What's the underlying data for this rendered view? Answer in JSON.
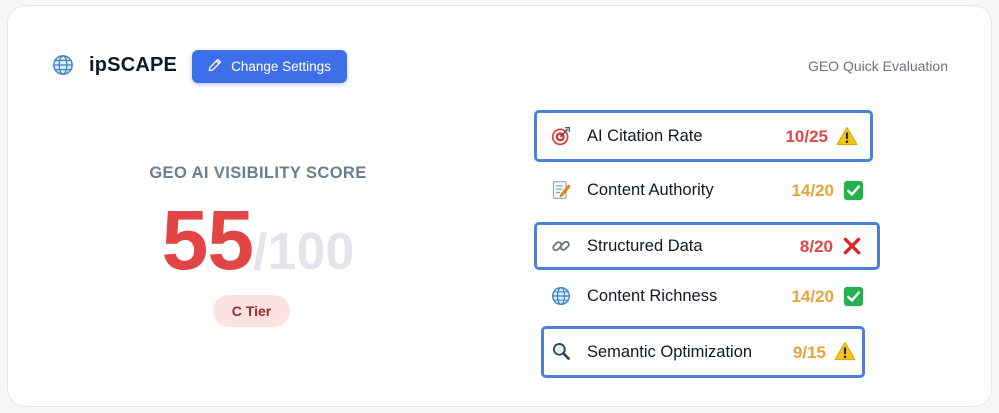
{
  "header": {
    "brand_name": "ipSCAPE",
    "brand_icon": "globe-icon",
    "change_settings_label": "Change Settings",
    "change_settings_icon": "pencil-icon",
    "evaluation_label": "GEO Quick Evaluation"
  },
  "score": {
    "label": "GEO AI VISIBILITY SCORE",
    "value": "55",
    "max": "/100",
    "tier": "C Tier",
    "value_color": "#e24545"
  },
  "metrics": [
    {
      "icon": "target-icon",
      "label": "AI Citation Rate",
      "score": "10/25",
      "score_color": "#e24545",
      "status": "warning-icon",
      "highlighted": true
    },
    {
      "icon": "memo-icon",
      "label": "Content Authority",
      "score": "14/20",
      "score_color": "#e8a33a",
      "status": "check-icon",
      "highlighted": false
    },
    {
      "icon": "link-icon",
      "label": "Structured Data",
      "score": "8/20",
      "score_color": "#e24545",
      "status": "cross-icon",
      "highlighted": true
    },
    {
      "icon": "globe-icon",
      "label": "Content Richness",
      "score": "14/20",
      "score_color": "#e8a33a",
      "status": "check-icon",
      "highlighted": false
    },
    {
      "icon": "magnifier-icon",
      "label": "Semantic Optimization",
      "score": "9/15",
      "score_color": "#e8a33a",
      "status": "warning-icon",
      "highlighted": true
    }
  ]
}
